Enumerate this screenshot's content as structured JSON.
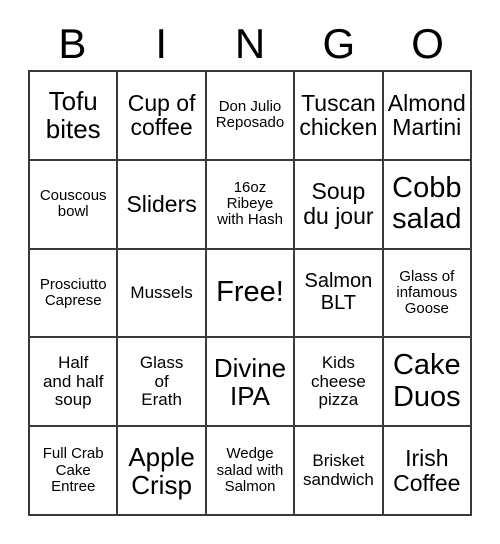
{
  "card": {
    "title": "BINGO",
    "header_letters": [
      "B",
      "I",
      "N",
      "G",
      "O"
    ],
    "columns": 5,
    "rows": 5,
    "colors": {
      "background": "#ffffff",
      "border": "#3a3a3a",
      "text": "#000000"
    },
    "free_space_label": "Free!",
    "free_space_position": {
      "row": 3,
      "column": 3
    },
    "cells": [
      [
        {
          "text": "Tofu\nbites",
          "size": "xxl"
        },
        {
          "text": "Cup of\ncoffee",
          "size": "xl"
        },
        {
          "text": "Don Julio\nReposado",
          "size": "s"
        },
        {
          "text": "Tuscan\nchicken",
          "size": "xl"
        },
        {
          "text": "Almond\nMartini",
          "size": "xl"
        }
      ],
      [
        {
          "text": "Couscous\nbowl",
          "size": "s"
        },
        {
          "text": "Sliders",
          "size": "xl"
        },
        {
          "text": "16oz\nRibeye\nwith Hash",
          "size": "s"
        },
        {
          "text": "Soup\ndu jour",
          "size": "xl"
        },
        {
          "text": "Cobb\nsalad",
          "size": "3xl"
        }
      ],
      [
        {
          "text": "Prosciutto\nCaprese",
          "size": "s"
        },
        {
          "text": "Mussels",
          "size": "m"
        },
        {
          "text": "Free!",
          "size": "3xl"
        },
        {
          "text": "Salmon\nBLT",
          "size": "l"
        },
        {
          "text": "Glass of\ninfamous\nGoose",
          "size": "s"
        }
      ],
      [
        {
          "text": "Half\nand half\nsoup",
          "size": "m"
        },
        {
          "text": "Glass\nof\nErath",
          "size": "m"
        },
        {
          "text": "Divine\nIPA",
          "size": "xxl"
        },
        {
          "text": "Kids\ncheese\npizza",
          "size": "m"
        },
        {
          "text": "Cake\nDuos",
          "size": "3xl"
        }
      ],
      [
        {
          "text": "Full Crab\nCake\nEntree",
          "size": "s"
        },
        {
          "text": "Apple\nCrisp",
          "size": "xxl"
        },
        {
          "text": "Wedge\nsalad with\nSalmon",
          "size": "s"
        },
        {
          "text": "Brisket\nsandwich",
          "size": "m"
        },
        {
          "text": "Irish\nCoffee",
          "size": "xl"
        }
      ]
    ]
  }
}
